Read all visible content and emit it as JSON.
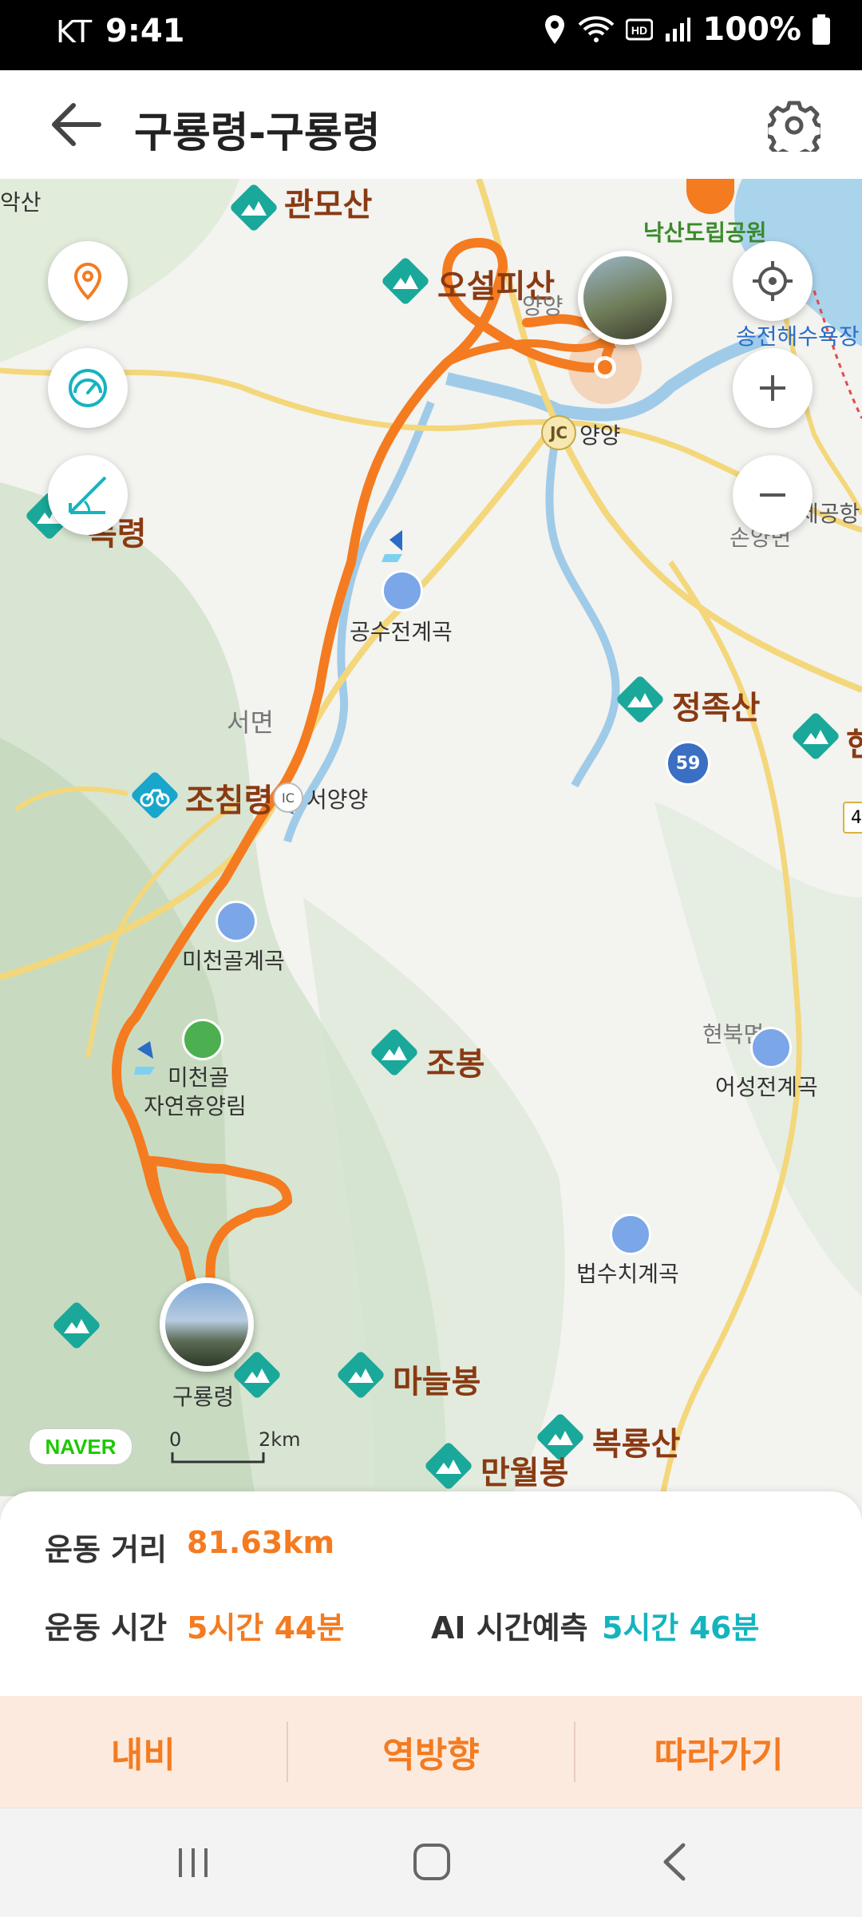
{
  "status_bar": {
    "carrier": "KT",
    "time": "9:41",
    "battery": "100%"
  },
  "header": {
    "title": "구룡령-구룡령"
  },
  "map": {
    "labels": {
      "aksan": "악산",
      "gwanmosan": "관모산",
      "naksan": "낙산도립공원",
      "oseolpisan": "오설피산",
      "yangyang_town": "양양",
      "songjeon": "송전해수욕장",
      "jc": "JC",
      "yangyang_jc": "양양",
      "mokryeong": "목령",
      "airport": "제공항",
      "sonyang": "손양면",
      "gongsujeon": "공수전계곡",
      "seomyeon": "서면",
      "jeongjoksan": "정족산",
      "route59": "59",
      "jochimryeong": "조침령",
      "ic": "IC",
      "seoyangyang": "서양양",
      "michengol_valley": "미천골계곡",
      "hyeonbuk": "현북면",
      "jobong": "조봉",
      "michengol_forest_1": "미천골",
      "michengol_forest_2": "자연휴양림",
      "eoseong": "어성전계곡",
      "beopsuchi": "법수치계곡",
      "guryong": "구룡령",
      "maneulbong": "마늘봉",
      "bokryongsan": "복룡산",
      "manwolbong": "만월봉",
      "right_edge_road": "4",
      "right_edge_peak": "현"
    },
    "naver_logo": "NAVER",
    "scale": {
      "zero": "0",
      "distance": "2km"
    }
  },
  "stats": {
    "distance_label": "운동 거리",
    "distance_value": "81.63km",
    "time_label": "운동 시간",
    "time_value": "5시간 44분",
    "ai_label": "AI 시간예측",
    "ai_value": "5시간 46분"
  },
  "actions": {
    "navi": "내비",
    "reverse": "역방향",
    "follow": "따라가기"
  },
  "colors": {
    "route": "#f47b20",
    "accent": "#f47b20",
    "teal": "#14b4bf",
    "peak": "#1aa89a"
  }
}
